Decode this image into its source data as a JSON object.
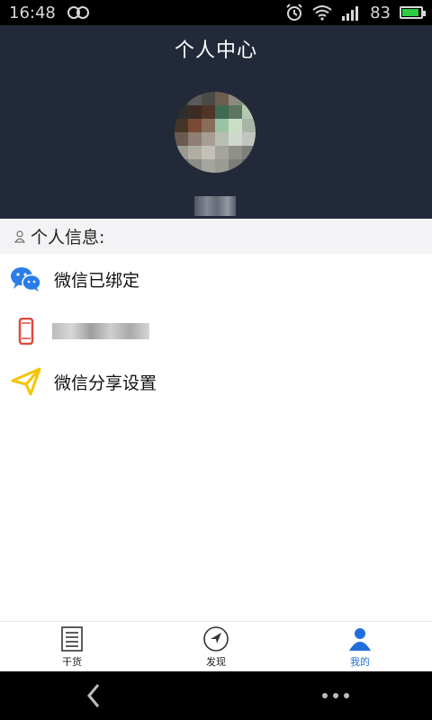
{
  "status_bar": {
    "time": "16:48",
    "battery_level": "83",
    "icons": [
      "link-icon",
      "alarm-icon",
      "wifi-icon",
      "signal-icon",
      "battery-icon"
    ]
  },
  "header": {
    "title": "个人中心",
    "background_color": "#222a3a"
  },
  "profile": {
    "avatar": "avatar-pixelated"
  },
  "section": {
    "title": "个人信息:"
  },
  "items": [
    {
      "label": "微信已绑定",
      "icon": "wechat-icon"
    },
    {
      "label": "",
      "icon": "phone-icon"
    },
    {
      "label": "微信分享设置",
      "icon": "paper-plane-icon"
    }
  ],
  "tabs": [
    {
      "label": "干货",
      "icon": "document-icon",
      "active": false
    },
    {
      "label": "发现",
      "icon": "compass-icon",
      "active": false
    },
    {
      "label": "我的",
      "icon": "user-icon",
      "active": true
    }
  ],
  "colors": {
    "accent": "#1e6fd9",
    "wechat": "#2b7de9",
    "phone": "#e0483e",
    "plane": "#f5c400"
  }
}
